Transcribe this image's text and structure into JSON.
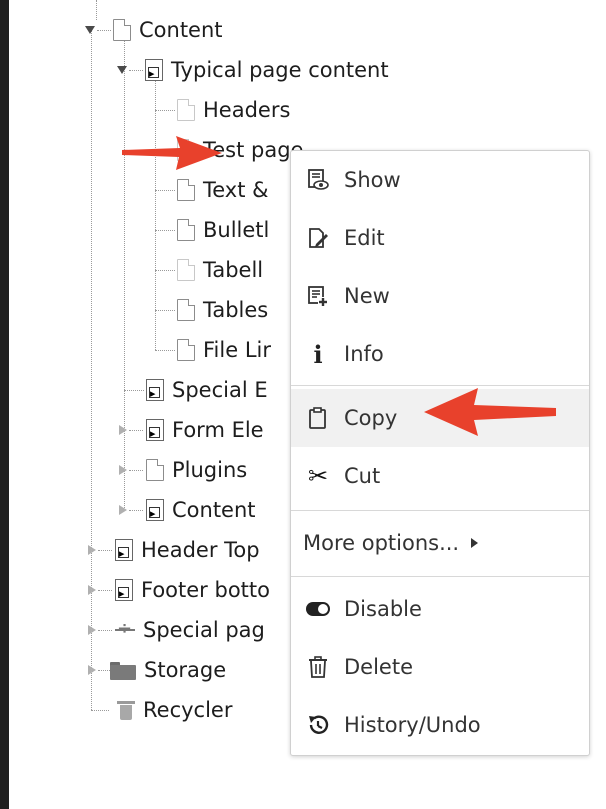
{
  "tree": {
    "items": [
      {
        "label": "Content"
      },
      {
        "label": "Typical page content"
      },
      {
        "label": "Headers"
      },
      {
        "label": "Test page"
      },
      {
        "label": "Text &"
      },
      {
        "label": "Bulletl"
      },
      {
        "label": "Tabell"
      },
      {
        "label": "Tables"
      },
      {
        "label": "File Lir"
      },
      {
        "label": "Special E"
      },
      {
        "label": "Form Ele"
      },
      {
        "label": "Plugins"
      },
      {
        "label": "Content"
      },
      {
        "label": "Header Top"
      },
      {
        "label": "Footer botto"
      },
      {
        "label": "Special pag"
      },
      {
        "label": "Storage"
      },
      {
        "label": "Recycler"
      }
    ]
  },
  "context_menu": {
    "show": "Show",
    "edit": "Edit",
    "new": "New",
    "info": "Info",
    "copy": "Copy",
    "cut": "Cut",
    "more_options": "More options...",
    "disable": "Disable",
    "delete": "Delete",
    "history_undo": "History/Undo"
  },
  "colors": {
    "annotation_arrow": "#e8412c",
    "menu_highlight": "#f1f1f1"
  }
}
